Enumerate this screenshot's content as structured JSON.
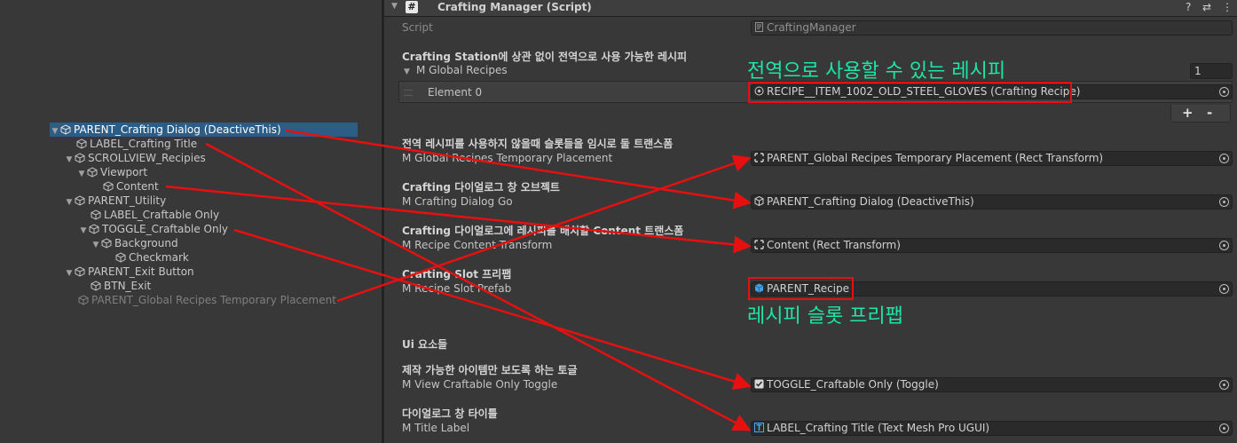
{
  "hierarchy": {
    "items": [
      {
        "label": "PARENT_Crafting Dialog (DeactiveThis)"
      },
      {
        "label": "LABEL_Crafting Title"
      },
      {
        "label": "SCROLLVIEW_Recipies"
      },
      {
        "label": "Viewport"
      },
      {
        "label": "Content"
      },
      {
        "label": "PARENT_Utility"
      },
      {
        "label": "LABEL_Craftable Only"
      },
      {
        "label": "TOGGLE_Craftable Only"
      },
      {
        "label": "Background"
      },
      {
        "label": "Checkmark"
      },
      {
        "label": "PARENT_Exit Button"
      },
      {
        "label": "BTN_Exit"
      },
      {
        "label": "PARENT_Global Recipes Temporary Placement"
      }
    ]
  },
  "component": {
    "title": "Crafting Manager (Script)",
    "icon_symbol": "#",
    "tools": {
      "help": "?",
      "presets": "⇄",
      "menu": "⋮"
    }
  },
  "inspector": {
    "script": {
      "label": "Script",
      "value": "CraftingManager"
    },
    "global_recipes": {
      "header": "Crafting Station에 상관 없이 전역으로 사용 가능한 레시피",
      "label": "M Global Recipes",
      "size": "1",
      "element_label": "Element 0",
      "element_value": "RECIPE__ITEM_1002_OLD_STEEL_GLOVES (Crafting Recipe)",
      "add_label": "+",
      "remove_label": "-"
    },
    "fields": [
      {
        "header": "전역 레시피를 사용하지 않을때 슬롯들을 임시로 둘 트랜스폼",
        "label": "M Global Recipes Temporary Placement",
        "value": "PARENT_Global Recipes Temporary Placement (Rect Transform)"
      },
      {
        "header": "Crafting 다이얼로그 창 오브젝트",
        "label": "M Crafting Dialog Go",
        "value": "PARENT_Crafting Dialog (DeactiveThis)"
      },
      {
        "header": "Crafting 다이얼로그에 레시피를 배치할 Content 트랜스폼",
        "label": "M Recipe Content Transform",
        "value": "Content (Rect Transform)"
      },
      {
        "header": "Crafting Slot 프리팹",
        "label": "M Recipe Slot Prefab",
        "value": "PARENT_Recipe"
      },
      {
        "header": "제작 가능한 아이템만 보도록 하는 토글",
        "label": "M View Craftable Only Toggle",
        "value": "TOGGLE_Craftable Only (Toggle)"
      },
      {
        "header": "다이얼로그 창 타이틀",
        "label": "M Title Label",
        "value": "LABEL_Crafting Title (Text Mesh Pro UGUI)"
      }
    ],
    "section_ui": "Ui 요소들"
  },
  "annotations": {
    "global_recipe_note": "전역으로 사용할 수 있는 레시피",
    "recipe_slot_note": "레시피 슬롯 프리팹"
  },
  "colors": {
    "annotation_text": "#1ee6a6",
    "annotation_line": "#e61010",
    "selection": "#2c5d87"
  }
}
